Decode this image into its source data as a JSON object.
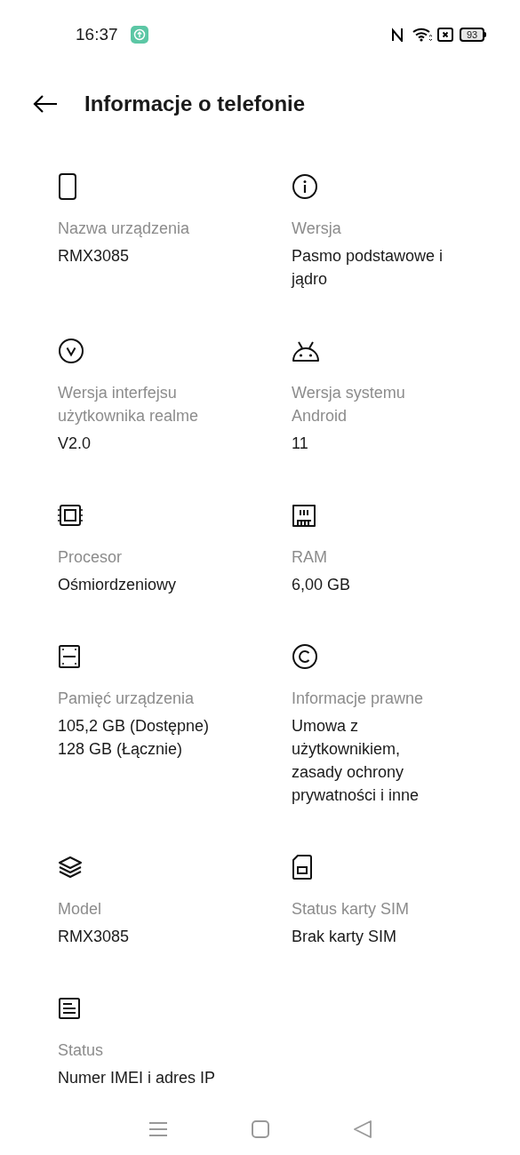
{
  "status_bar": {
    "time": "16:37",
    "battery": "93"
  },
  "title": "Informacje o telefonie",
  "items": [
    {
      "kind": "phone",
      "label": "Nazwa urządzenia",
      "value": "RMX3085"
    },
    {
      "kind": "info",
      "label": "Wersja",
      "value": "Pasmo podstawowe i\njądro"
    },
    {
      "kind": "version",
      "label": "Wersja interfejsu\nużytkownika realme",
      "value": "V2.0"
    },
    {
      "kind": "android",
      "label": "Wersja systemu\nAndroid",
      "value": "11"
    },
    {
      "kind": "cpu",
      "label": "Procesor",
      "value": "Ośmiordzeniowy"
    },
    {
      "kind": "ram",
      "label": "RAM",
      "value": "6,00 GB"
    },
    {
      "kind": "storage",
      "label": "Pamięć urządzenia",
      "value": "105,2 GB (Dostępne)\n128 GB (Łącznie)"
    },
    {
      "kind": "copyright",
      "label": "Informacje prawne",
      "value": "Umowa z\nużytkownikiem,\nzasady ochrony\nprywatności i inne"
    },
    {
      "kind": "layers",
      "label": "Model",
      "value": "RMX3085"
    },
    {
      "kind": "sim",
      "label": "Status karty SIM",
      "value": "Brak karty SIM"
    },
    {
      "kind": "document",
      "label": "Status",
      "value": "Numer IMEI i adres IP"
    }
  ]
}
